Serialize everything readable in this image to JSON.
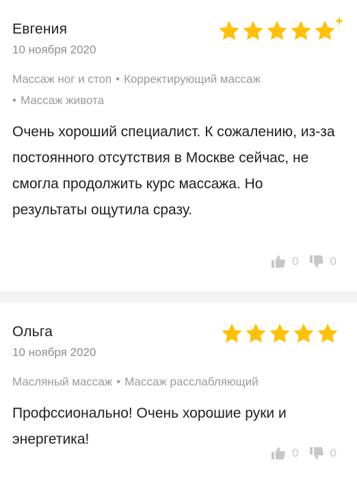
{
  "colors": {
    "star": "#ffc107",
    "muted": "#9a9a9a",
    "divider": "#f3f3f5",
    "vote": "#c7c7c7"
  },
  "reviews": [
    {
      "author": "Евгения",
      "date": "10 ноября 2020",
      "rating": 5,
      "tags": [
        "Массаж ног и стоп",
        "Корректирующий массаж",
        "Массаж живота"
      ],
      "text": "Очень хороший специалист. К сожалению, из-за постоянного отсутствия в Москве сейчас, не смогла продолжить курс массажа. Но результаты ощутила сразу.",
      "likes": "0",
      "dislikes": "0"
    },
    {
      "author": "Ольга",
      "date": "10 ноября 2020",
      "rating": 5,
      "tags": [
        "Масляный массаж",
        "Массаж расслабляющий"
      ],
      "text": "Профссионально! Очень хорошие руки и энергетика!",
      "likes": "0",
      "dislikes": "0"
    }
  ],
  "icons": {
    "star": "star-icon",
    "sparkle": "sparkle-icon",
    "like": "thumbs-up-icon",
    "dislike": "thumbs-down-icon"
  }
}
